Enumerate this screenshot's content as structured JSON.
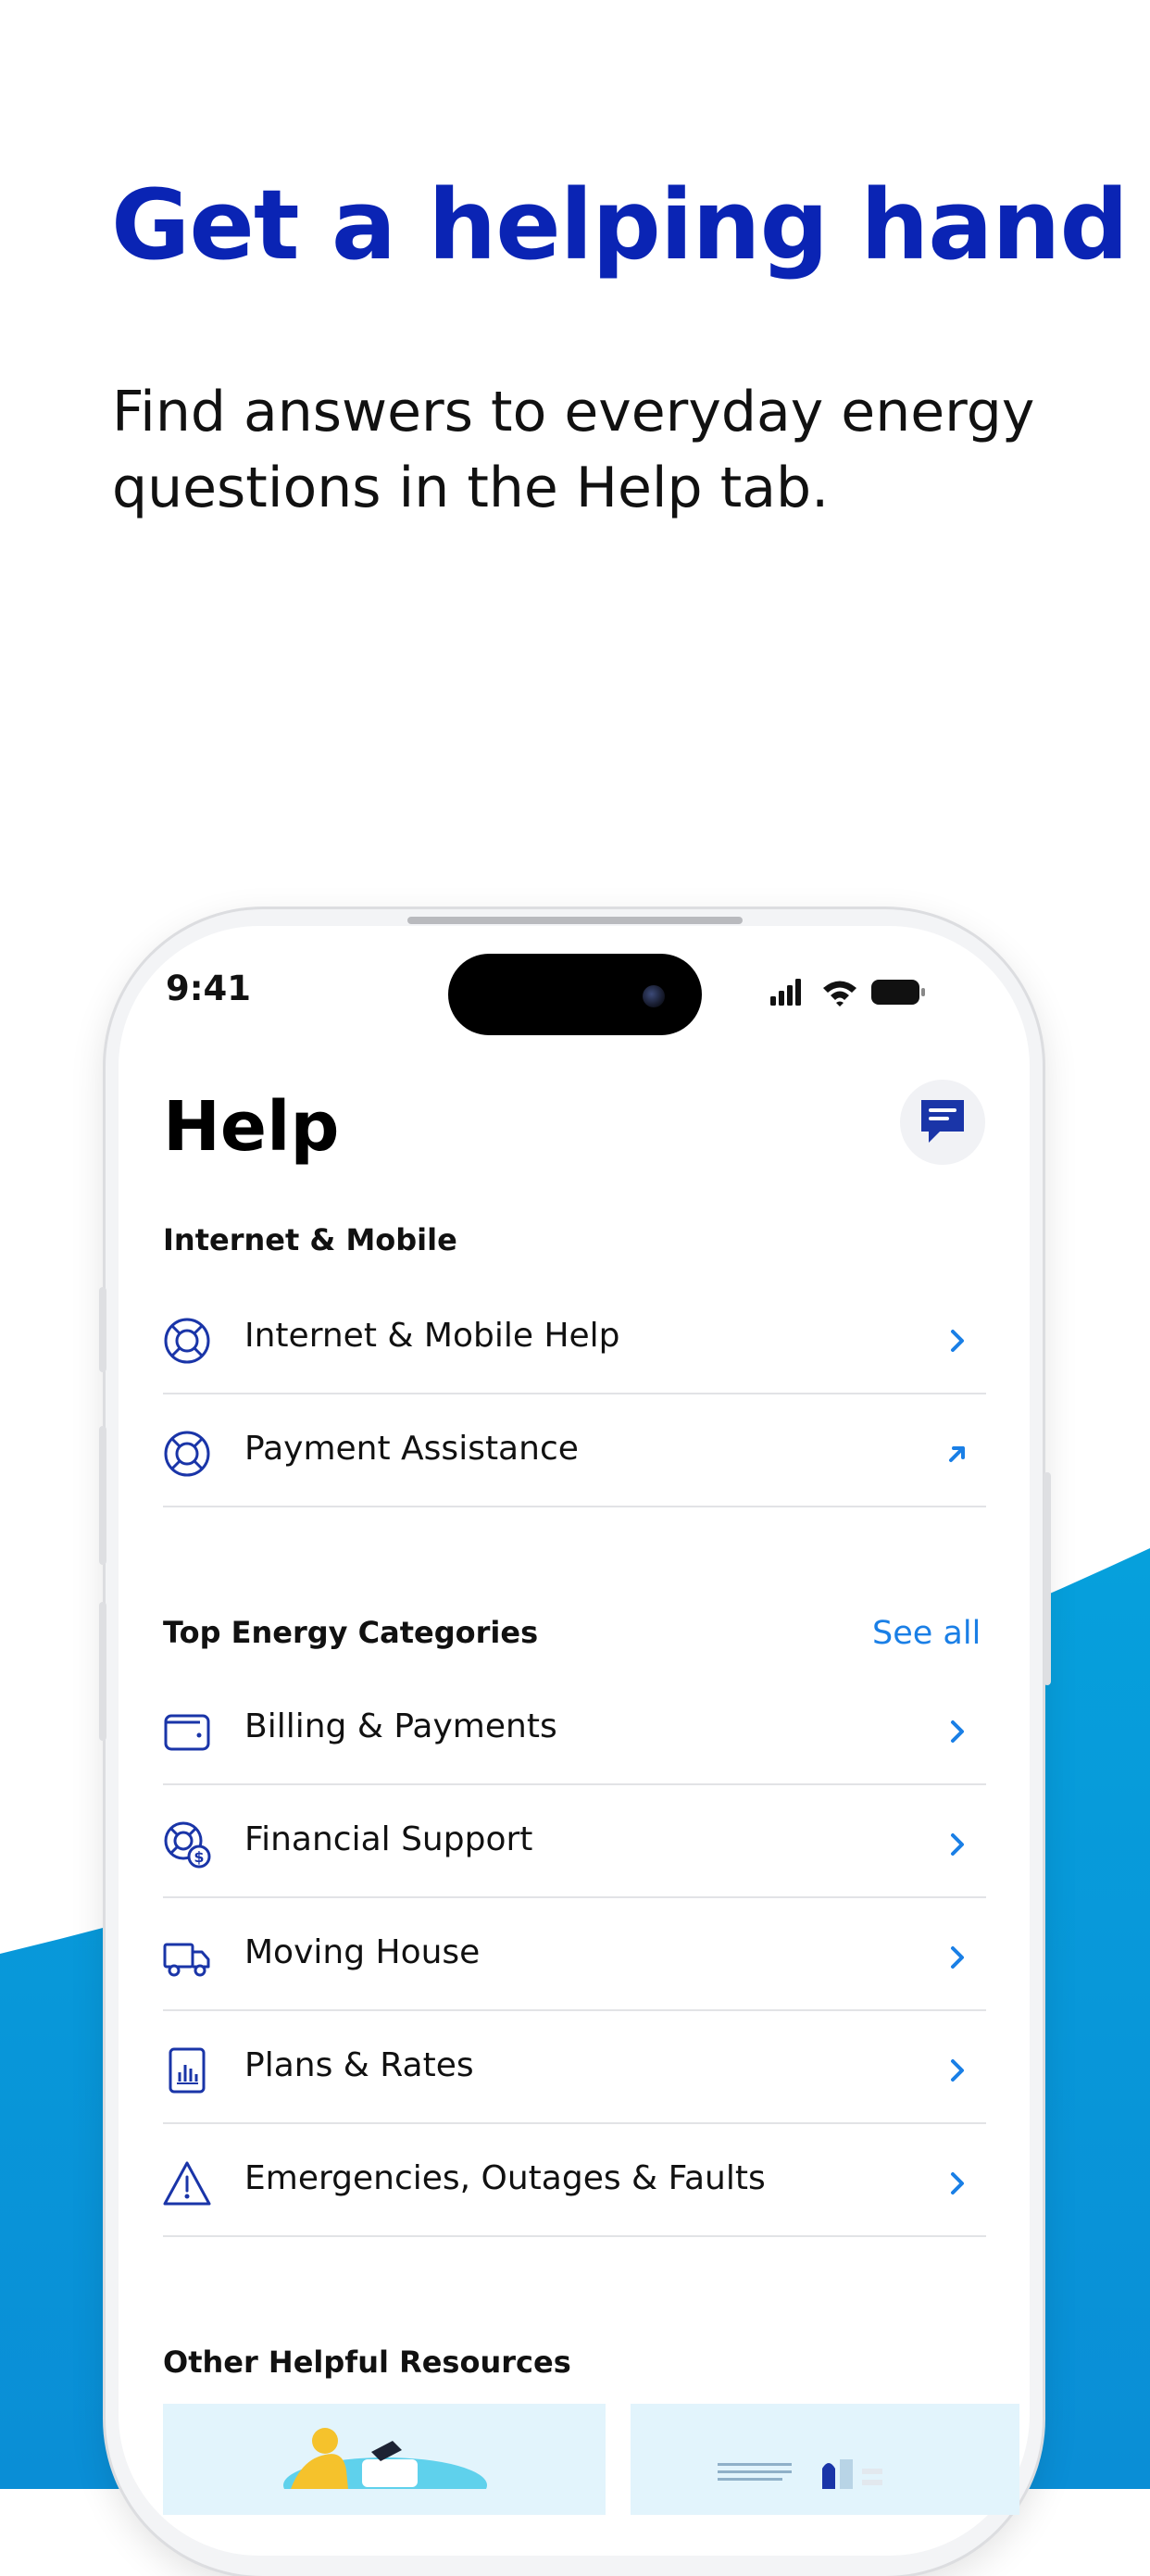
{
  "headline": "Get a helping hand",
  "subline": "Find answers to everyday energy questions in the Help tab.",
  "colors": {
    "headline": "#0a24b4",
    "icon_navy": "#1a35a8",
    "link_blue": "#1a7fe6",
    "wave_top": "#06a0dc",
    "wave_bottom": "#0a8ed6"
  },
  "status_bar": {
    "time": "9:41",
    "icons": [
      "signal-icon",
      "wifi-icon",
      "battery-icon"
    ]
  },
  "help_screen": {
    "title": "Help",
    "chat_icon": "chat-bubble-icon",
    "internet_section": {
      "label": "Internet & Mobile",
      "items": [
        {
          "label": "Internet & Mobile Help",
          "icon": "lifebuoy-icon",
          "action": "chevron-right-icon"
        },
        {
          "label": "Payment Assistance",
          "icon": "lifebuoy-icon",
          "action": "external-link-icon"
        }
      ]
    },
    "energy_section": {
      "label": "Top Energy Categories",
      "see_all": "See all",
      "items": [
        {
          "label": "Billing & Payments",
          "icon": "wallet-icon"
        },
        {
          "label": "Financial Support",
          "icon": "lifebuoy-dollar-icon"
        },
        {
          "label": "Moving House",
          "icon": "truck-icon"
        },
        {
          "label": "Plans & Rates",
          "icon": "document-chart-icon"
        },
        {
          "label": "Emergencies, Outages & Faults",
          "icon": "warning-icon"
        }
      ]
    },
    "resources_section": {
      "label": "Other Helpful Resources",
      "cards": [
        "illustration-person-card",
        "illustration-items-card"
      ]
    }
  }
}
